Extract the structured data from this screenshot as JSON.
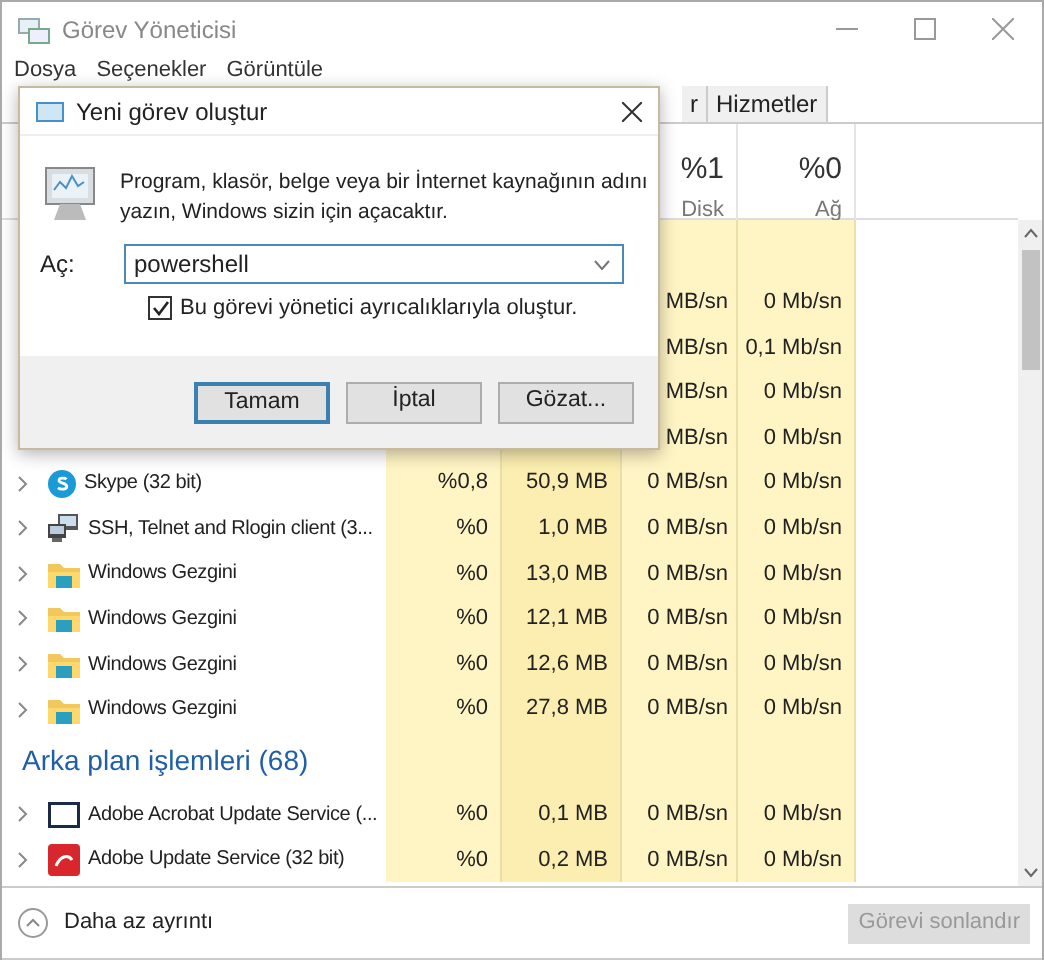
{
  "window": {
    "title": "Görev Yöneticisi"
  },
  "menu": [
    "Dosya",
    "Seçenekler",
    "Görüntüle"
  ],
  "tabs": [
    {
      "label": "r",
      "selected": false
    },
    {
      "label": "Hizmetler",
      "selected": false
    }
  ],
  "header": {
    "disk": {
      "value": "%1",
      "label": "Disk"
    },
    "network": {
      "value": "%0",
      "label": "Ağ"
    }
  },
  "app_rows": [
    {
      "disk": "MB/sn",
      "network": "0 Mb/sn"
    },
    {
      "disk": "MB/sn",
      "network": "0,1 Mb/sn"
    },
    {
      "disk": "MB/sn",
      "network": "0 Mb/sn"
    },
    {
      "disk": "MB/sn",
      "network": "0 Mb/sn"
    },
    {
      "name": "Skype (32 bit)",
      "kind": "skype",
      "cpu": "%0,8",
      "memory": "50,9 MB",
      "disk": "0 MB/sn",
      "network": "0 Mb/sn"
    },
    {
      "name": "SSH, Telnet and Rlogin client (3...",
      "kind": "terminal",
      "cpu": "%0",
      "memory": "1,0 MB",
      "disk": "0 MB/sn",
      "network": "0 Mb/sn"
    },
    {
      "name": "Windows Gezgini",
      "kind": "folder",
      "cpu": "%0",
      "memory": "13,0 MB",
      "disk": "0 MB/sn",
      "network": "0 Mb/sn"
    },
    {
      "name": "Windows Gezgini",
      "kind": "folder",
      "cpu": "%0",
      "memory": "12,1 MB",
      "disk": "0 MB/sn",
      "network": "0 Mb/sn"
    },
    {
      "name": "Windows Gezgini",
      "kind": "folder",
      "cpu": "%0",
      "memory": "12,6 MB",
      "disk": "0 MB/sn",
      "network": "0 Mb/sn"
    },
    {
      "name": "Windows Gezgini",
      "kind": "folder",
      "cpu": "%0",
      "memory": "27,8 MB",
      "disk": "0 MB/sn",
      "network": "0 Mb/sn"
    }
  ],
  "background_section": {
    "title": "Arka plan işlemleri (68)",
    "rows": [
      {
        "name": "Adobe Acrobat Update Service (...",
        "kind": "window",
        "cpu": "%0",
        "memory": "0,1 MB",
        "disk": "0 MB/sn",
        "network": "0 Mb/sn"
      },
      {
        "name": "Adobe Update Service (32 bit)",
        "kind": "adobe",
        "cpu": "%0",
        "memory": "0,2 MB",
        "disk": "0 MB/sn",
        "network": "0 Mb/sn"
      }
    ]
  },
  "dialog": {
    "title": "Yeni görev oluştur",
    "message": "Program, klasör, belge veya bir İnternet kaynağının adını yazın, Windows sizin için açacaktır.",
    "open_label": "Aç:",
    "open_value": "powershell",
    "admin_checkbox": {
      "label": "Bu görevi yönetici ayrıcalıklarıyla oluştur.",
      "checked": true
    },
    "buttons": [
      {
        "label": "Tamam",
        "focused": true
      },
      {
        "label": "İptal",
        "focused": false
      },
      {
        "label": "Gözat...",
        "focused": false
      }
    ]
  },
  "footer": {
    "toggle": "Daha az ayrıntı",
    "end_task": {
      "label": "Görevi sonlandır",
      "disabled": true
    }
  }
}
